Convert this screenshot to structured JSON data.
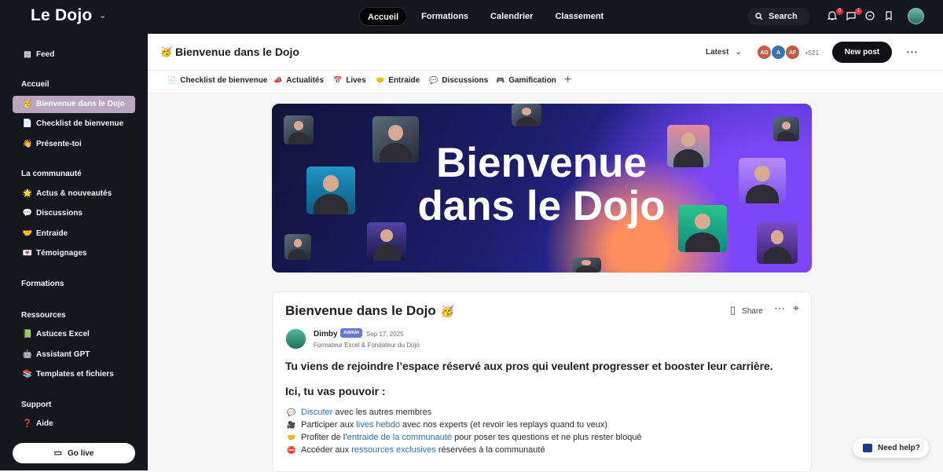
{
  "topbar": {
    "brand": "Le Dojo",
    "nav": [
      "Accueil",
      "Formations",
      "Calendrier",
      "Classement"
    ],
    "search": "Search",
    "notifications": "3",
    "messages": "1"
  },
  "sidebar": {
    "feed": "Feed",
    "sections": [
      {
        "title": "Accueil",
        "items": [
          {
            "label": "Bienvenue dans le Dojo",
            "icon": "🥳",
            "active": true
          },
          {
            "label": "Checklist de bienvenue",
            "icon": "📄"
          },
          {
            "label": "Présente-toi",
            "icon": "👋"
          }
        ]
      },
      {
        "title": "La communauté",
        "items": [
          {
            "label": "Actus & nouveautés",
            "icon": "🌟"
          },
          {
            "label": "Discussions",
            "icon": "💬"
          },
          {
            "label": "Entraide",
            "icon": "🤝"
          },
          {
            "label": "Témoignages",
            "icon": "💌"
          }
        ]
      },
      {
        "title": "Formations",
        "items": []
      },
      {
        "title": "Ressources",
        "items": [
          {
            "label": "Astuces Excel",
            "icon": "📗"
          },
          {
            "label": "Assistant GPT",
            "icon": "🤖"
          },
          {
            "label": "Templates et fichiers",
            "icon": "📚"
          }
        ]
      },
      {
        "title": "Support",
        "items": [
          {
            "label": "Aide",
            "icon": "❓"
          }
        ]
      }
    ],
    "go_live": "Go live"
  },
  "main": {
    "title": "Bienvenue dans le Dojo",
    "title_emoji": "🥳",
    "sort": "Latest",
    "members": [
      "AD",
      "A",
      "AF"
    ],
    "member_count": "+521",
    "new_post": "New post",
    "tabs": [
      {
        "label": "Checklist de bienvenue",
        "icon": "📄"
      },
      {
        "label": "Actualités",
        "icon": "📣"
      },
      {
        "label": "Lives",
        "icon": "📅"
      },
      {
        "label": "Entraide",
        "icon": "🤝"
      },
      {
        "label": "Discussions",
        "icon": "💬"
      },
      {
        "label": "Gamification",
        "icon": "🎮"
      }
    ],
    "banner_text": "Bienvenue dans le Dojo"
  },
  "post": {
    "title": "Bienvenue dans le Dojo",
    "title_emoji": "🥳",
    "share": "Share",
    "author": "Dimby",
    "role": "Admin",
    "date": "Sep 17, 2025",
    "subtitle": "Formateur Excel & Fondateur du Dojo",
    "lead": "Tu viens de rejoindre l’espace réservé aux pros qui veulent progresser et booster leur carrière.",
    "section": "Ici, tu vas pouvoir :",
    "bullets": [
      {
        "icon": "💬",
        "before": "",
        "link": "Discuter",
        "after": " avec les autres membres"
      },
      {
        "icon": "🎥",
        "before": "Participer aux ",
        "link": "lives hebdo",
        "after": " avec nos experts (et revoir les replays quand tu veux)"
      },
      {
        "icon": "🤝",
        "before": "Profiter de l’",
        "link": "entraide de la communauté",
        "after": " pour poser tes questions et ne plus rester bloqué"
      },
      {
        "icon": "⛔",
        "before": "Accéder aux ",
        "link": "ressources exclusives",
        "after": " réservées à la communauté"
      }
    ]
  },
  "help": "Need help?",
  "colors": {
    "dark": "#16161e",
    "active": "#b9a7c0",
    "accent": "#2c72c5",
    "banner": "#2f2db8"
  }
}
